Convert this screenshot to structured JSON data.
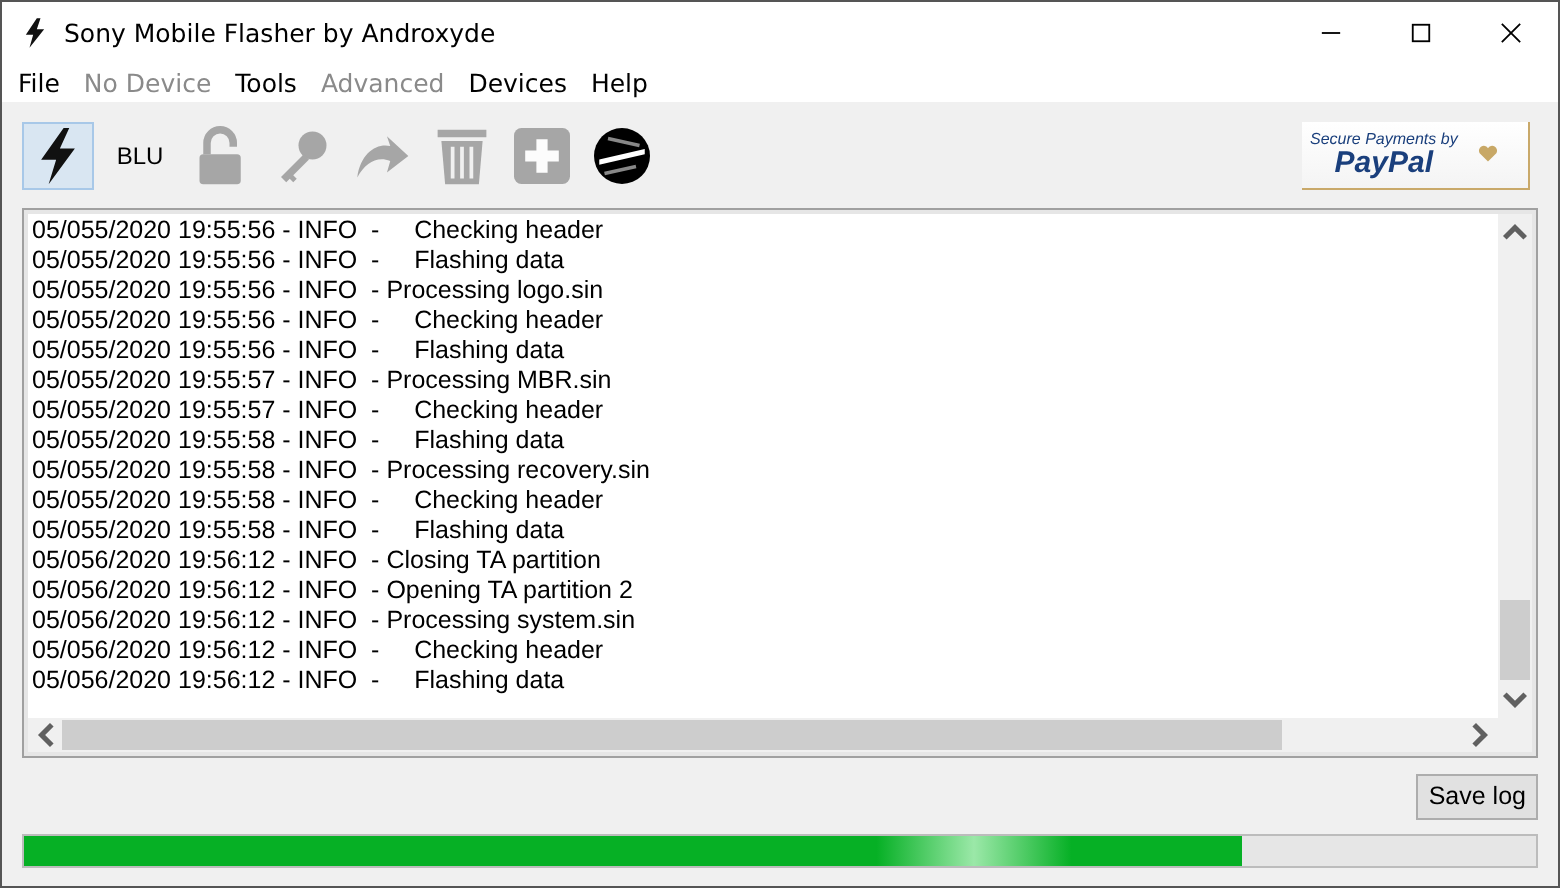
{
  "window": {
    "title": "Sony Mobile Flasher by Androxyde"
  },
  "menu": [
    {
      "label": "File",
      "disabled": false
    },
    {
      "label": "No Device",
      "disabled": true
    },
    {
      "label": "Tools",
      "disabled": false
    },
    {
      "label": "Advanced",
      "disabled": true
    },
    {
      "label": "Devices",
      "disabled": false
    },
    {
      "label": "Help",
      "disabled": false
    }
  ],
  "toolbar": [
    {
      "kind": "flash",
      "selected": true,
      "disabled": false
    },
    {
      "kind": "text",
      "label": "BLU",
      "selected": false,
      "disabled": false
    },
    {
      "kind": "lock",
      "selected": false,
      "disabled": true
    },
    {
      "kind": "key",
      "selected": false,
      "disabled": true
    },
    {
      "kind": "redo",
      "selected": false,
      "disabled": true
    },
    {
      "kind": "trash",
      "selected": false,
      "disabled": true
    },
    {
      "kind": "plus",
      "selected": false,
      "disabled": true
    },
    {
      "kind": "xf",
      "selected": false,
      "disabled": false
    }
  ],
  "paypal": {
    "caption": "Secure Payments by",
    "brand": "PayPal"
  },
  "log": [
    "05/055/2020 19:55:56 - INFO  -     Checking header",
    "05/055/2020 19:55:56 - INFO  -     Flashing data",
    "05/055/2020 19:55:56 - INFO  - Processing logo.sin",
    "05/055/2020 19:55:56 - INFO  -     Checking header",
    "05/055/2020 19:55:56 - INFO  -     Flashing data",
    "05/055/2020 19:55:57 - INFO  - Processing MBR.sin",
    "05/055/2020 19:55:57 - INFO  -     Checking header",
    "05/055/2020 19:55:58 - INFO  -     Flashing data",
    "05/055/2020 19:55:58 - INFO  - Processing recovery.sin",
    "05/055/2020 19:55:58 - INFO  -     Checking header",
    "05/055/2020 19:55:58 - INFO  -     Flashing data",
    "05/056/2020 19:56:12 - INFO  - Closing TA partition",
    "05/056/2020 19:56:12 - INFO  - Opening TA partition 2",
    "05/056/2020 19:56:12 - INFO  - Processing system.sin",
    "05/056/2020 19:56:12 - INFO  -     Checking header",
    "05/056/2020 19:56:12 - INFO  -     Flashing data"
  ],
  "save_button": "Save log",
  "progress": {
    "level": 0.805
  }
}
